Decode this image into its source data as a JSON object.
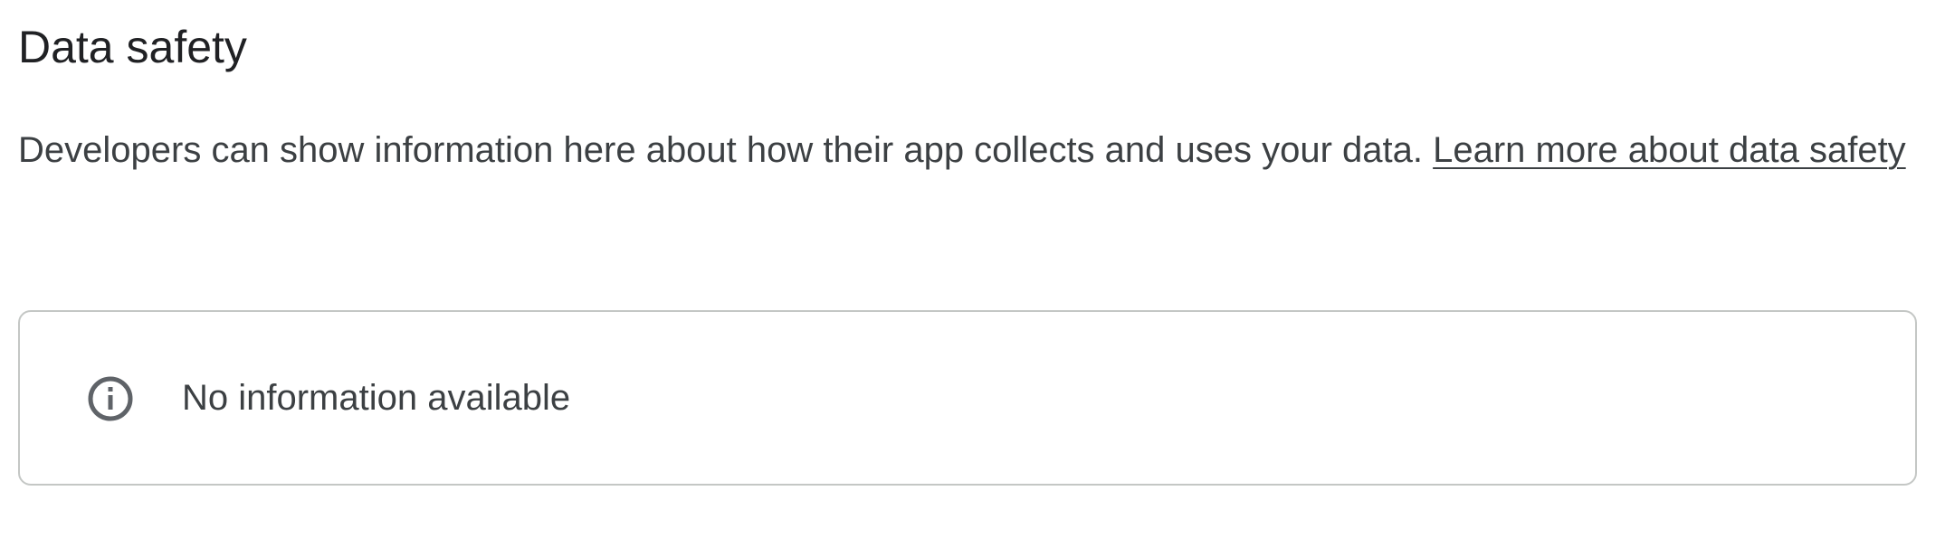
{
  "section": {
    "title": "Data safety",
    "description": "Developers can show information here about how their app collects and uses your data. ",
    "learn_more_link": "Learn more about data safety"
  },
  "info_card": {
    "icon": "info-icon",
    "message": "No information available"
  }
}
